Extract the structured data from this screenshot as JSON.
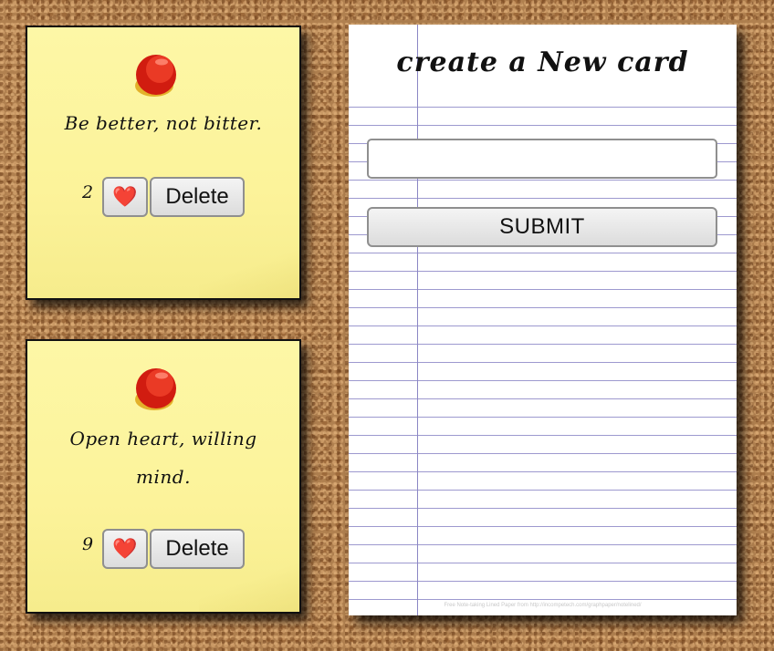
{
  "cards": [
    {
      "quote": "Be better, not bitter.",
      "likes": "2",
      "like_icon": "❤️",
      "delete_label": "Delete"
    },
    {
      "quote": "Open heart, willing mind.",
      "likes": "9",
      "like_icon": "❤️",
      "delete_label": "Delete"
    }
  ],
  "form": {
    "title": "create a New card",
    "input_value": "",
    "input_placeholder": "",
    "submit_label": "SUBMIT",
    "credit": "Free Note-taking Lined Paper from http://incompetech.com/graphpaper/notelined/"
  },
  "icons": {
    "pin": "pushpin-icon",
    "like": "heart-icon"
  },
  "colors": {
    "note": "#fcf39a",
    "pin": "#e0231a",
    "paper_line": "#9d99cf",
    "cork": "#b0804f"
  }
}
